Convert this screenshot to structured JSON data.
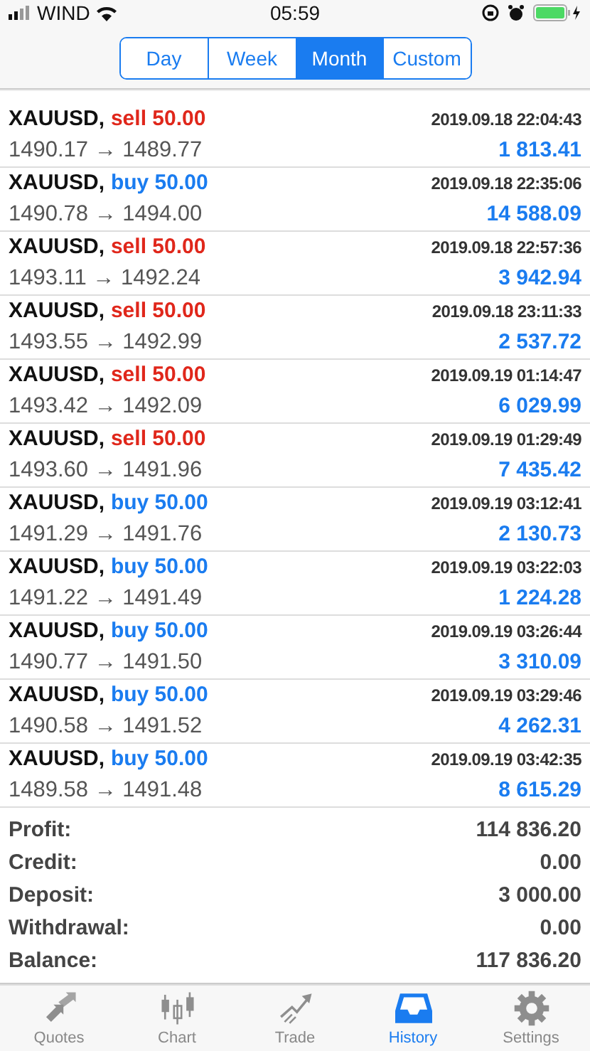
{
  "status_bar": {
    "carrier": "WIND",
    "time": "05:59"
  },
  "period_tabs": [
    {
      "label": "Day",
      "selected": false
    },
    {
      "label": "Week",
      "selected": false
    },
    {
      "label": "Month",
      "selected": true
    },
    {
      "label": "Custom",
      "selected": false
    }
  ],
  "deals": [
    {
      "symbol": "XAUUSD,",
      "kind": "sell",
      "order": "sell 50.00",
      "time": "2019.09.18 22:04:43",
      "prices": "1490.17 → 1489.77",
      "profit": "1 813.41"
    },
    {
      "symbol": "XAUUSD,",
      "kind": "buy",
      "order": "buy 50.00",
      "time": "2019.09.18 22:35:06",
      "prices": "1490.78 → 1494.00",
      "profit": "14 588.09"
    },
    {
      "symbol": "XAUUSD,",
      "kind": "sell",
      "order": "sell 50.00",
      "time": "2019.09.18 22:57:36",
      "prices": "1493.11 → 1492.24",
      "profit": "3 942.94"
    },
    {
      "symbol": "XAUUSD,",
      "kind": "sell",
      "order": "sell 50.00",
      "time": "2019.09.18 23:11:33",
      "prices": "1493.55 → 1492.99",
      "profit": "2 537.72"
    },
    {
      "symbol": "XAUUSD,",
      "kind": "sell",
      "order": "sell 50.00",
      "time": "2019.09.19 01:14:47",
      "prices": "1493.42 → 1492.09",
      "profit": "6 029.99"
    },
    {
      "symbol": "XAUUSD,",
      "kind": "sell",
      "order": "sell 50.00",
      "time": "2019.09.19 01:29:49",
      "prices": "1493.60 → 1491.96",
      "profit": "7 435.42"
    },
    {
      "symbol": "XAUUSD,",
      "kind": "buy",
      "order": "buy 50.00",
      "time": "2019.09.19 03:12:41",
      "prices": "1491.29 → 1491.76",
      "profit": "2 130.73"
    },
    {
      "symbol": "XAUUSD,",
      "kind": "buy",
      "order": "buy 50.00",
      "time": "2019.09.19 03:22:03",
      "prices": "1491.22 → 1491.49",
      "profit": "1 224.28"
    },
    {
      "symbol": "XAUUSD,",
      "kind": "buy",
      "order": "buy 50.00",
      "time": "2019.09.19 03:26:44",
      "prices": "1490.77 → 1491.50",
      "profit": "3 310.09"
    },
    {
      "symbol": "XAUUSD,",
      "kind": "buy",
      "order": "buy 50.00",
      "time": "2019.09.19 03:29:46",
      "prices": "1490.58 → 1491.52",
      "profit": "4 262.31"
    },
    {
      "symbol": "XAUUSD,",
      "kind": "buy",
      "order": "buy 50.00",
      "time": "2019.09.19 03:42:35",
      "prices": "1489.58 → 1491.48",
      "profit": "8 615.29"
    }
  ],
  "summary": [
    {
      "label": "Profit:",
      "value": "114 836.20"
    },
    {
      "label": "Credit:",
      "value": "0.00"
    },
    {
      "label": "Deposit:",
      "value": "3 000.00"
    },
    {
      "label": "Withdrawal:",
      "value": "0.00"
    },
    {
      "label": "Balance:",
      "value": "117 836.20"
    }
  ],
  "tab_bar": [
    {
      "kind": "quotes",
      "label": "Quotes",
      "selected": false
    },
    {
      "kind": "chart",
      "label": "Chart",
      "selected": false
    },
    {
      "kind": "trade",
      "label": "Trade",
      "selected": false
    },
    {
      "kind": "history",
      "label": "History",
      "selected": true
    },
    {
      "kind": "settings",
      "label": "Settings",
      "selected": false
    }
  ]
}
